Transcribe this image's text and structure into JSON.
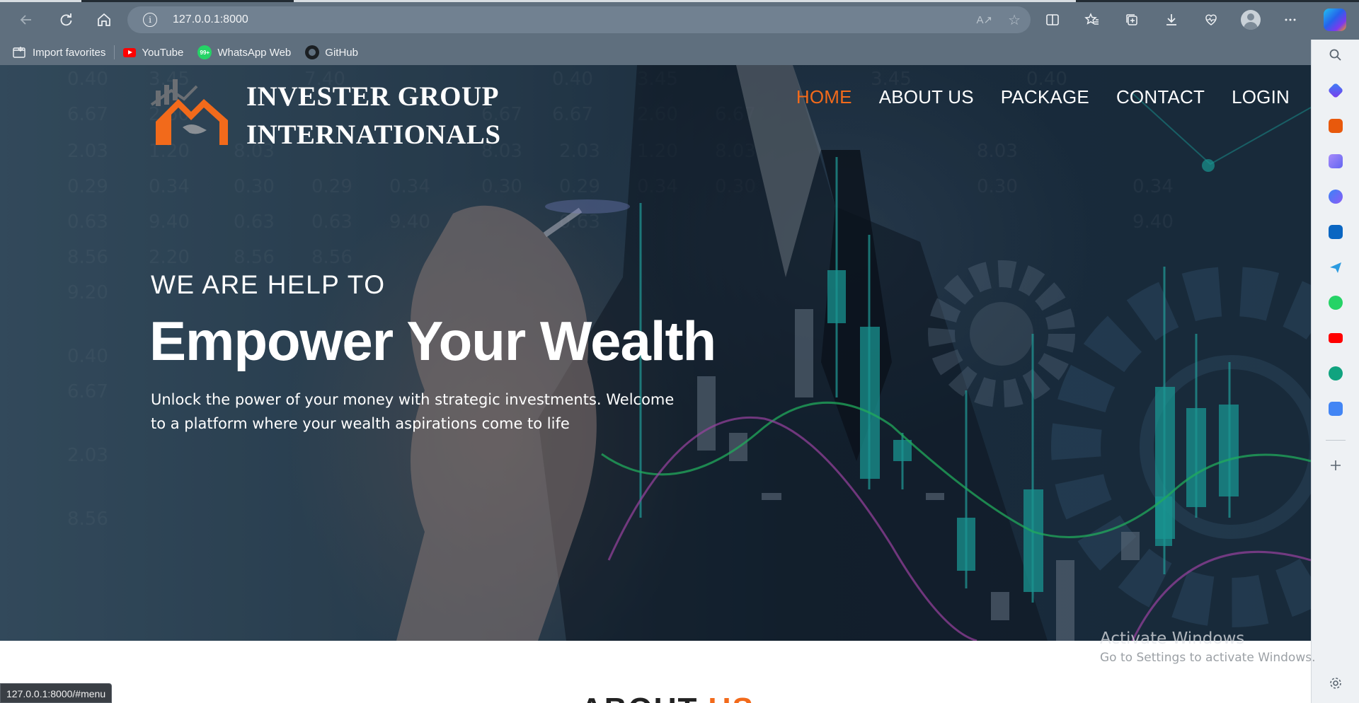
{
  "browser": {
    "url": "127.0.0.1:8000",
    "status_url": "127.0.0.1:8000/#menu",
    "bookmarks": [
      {
        "label": "Import favorites",
        "icon": "import-favorites-icon"
      },
      {
        "label": "YouTube",
        "icon": "youtube-icon"
      },
      {
        "label": "WhatsApp Web",
        "icon": "whatsapp-icon",
        "badge": "99+"
      },
      {
        "label": "GitHub",
        "icon": "github-icon"
      }
    ]
  },
  "site": {
    "brand_line1": "INVESTER GROUP",
    "brand_line2": "INTERNATIONALS",
    "nav": [
      {
        "label": "HOME",
        "active": true
      },
      {
        "label": "ABOUT US",
        "active": false
      },
      {
        "label": "PACKAGE",
        "active": false
      },
      {
        "label": "CONTACT",
        "active": false
      },
      {
        "label": "LOGIN",
        "active": false
      }
    ],
    "hero": {
      "kicker": "WE ARE HELP TO",
      "headline": "Empower Your Wealth",
      "lead": "Unlock the power of your money with strategic investments. Welcome to a platform where your wealth aspirations come to life"
    },
    "section_peek": {
      "part1": "ABOUT",
      "part2": "US"
    }
  },
  "system": {
    "watermark_title": "Activate Windows",
    "watermark_sub": "Go to Settings to activate Windows."
  },
  "colors": {
    "accent_orange": "#f26a1b",
    "chrome_bg": "#5f6f7e",
    "sidebar_bg": "#eef1f4"
  }
}
